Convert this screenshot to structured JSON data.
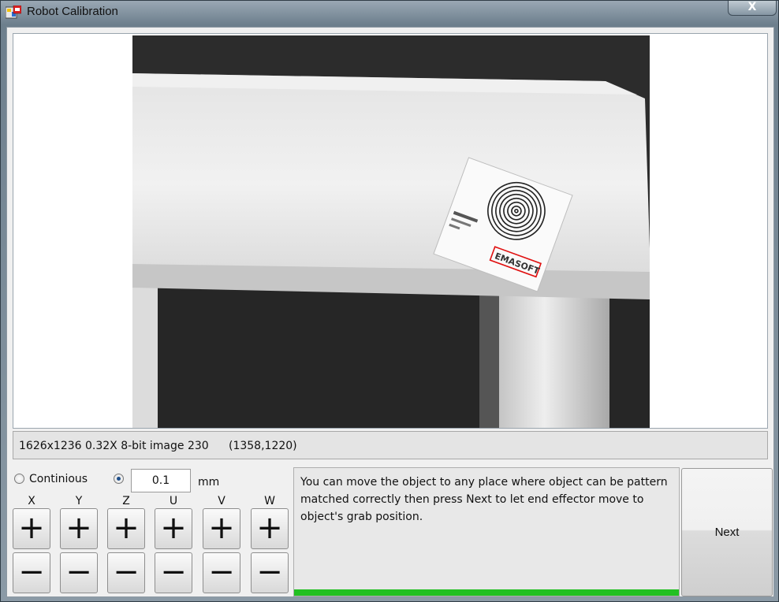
{
  "window": {
    "title": "Robot Calibration",
    "close_label": "X"
  },
  "viewer": {
    "target_logo_text": "EMASOFT"
  },
  "status": {
    "image_info": "1626x1236 0.32X 8-bit image 230",
    "coords": "(1358,1220)"
  },
  "jog": {
    "continuous_label": "Continious",
    "continuous_selected": false,
    "step_selected": true,
    "step_value": "0.1",
    "unit": "mm",
    "axes": [
      "X",
      "Y",
      "Z",
      "U",
      "V",
      "W"
    ],
    "plus_symbol": "+",
    "minus_symbol": "−"
  },
  "message": {
    "text": "You can move the object to any place where object can be pattern matched correctly then press Next to let end effector move to object's grab position."
  },
  "progress": {
    "percent": 100,
    "color": "#22c022"
  },
  "next_label": "Next"
}
